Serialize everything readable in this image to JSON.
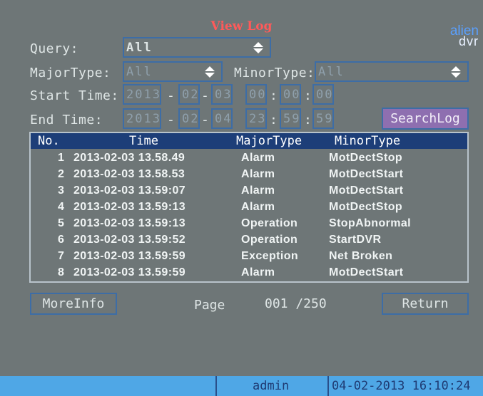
{
  "title": "View Log",
  "logo": {
    "line1": "alien",
    "line2": "dvr"
  },
  "query": {
    "label": "Query:",
    "value": "All"
  },
  "major_type": {
    "label": "MajorType:",
    "value": "All"
  },
  "minor_type": {
    "label": "MinorType:",
    "value": "All"
  },
  "start_time": {
    "label": "Start Time:",
    "year": "2013",
    "month": "02",
    "day": "03",
    "hour": "00",
    "minute": "00",
    "second": "00"
  },
  "end_time": {
    "label": "End Time:",
    "year": "2013",
    "month": "02",
    "day": "04",
    "hour": "23",
    "minute": "59",
    "second": "59"
  },
  "search_button": "SearchLog",
  "table": {
    "headers": [
      "No.",
      "Time",
      "MajorType",
      "MinorType"
    ],
    "rows": [
      {
        "no": "1",
        "time": "2013-02-03 13.58.49",
        "major": "Alarm",
        "minor": "MotDectStop"
      },
      {
        "no": "2",
        "time": "2013-02-03 13.58.53",
        "major": "Alarm",
        "minor": "MotDectStart"
      },
      {
        "no": "3",
        "time": "2013-02-03 13.59:07",
        "major": "Alarm",
        "minor": "MotDectStart"
      },
      {
        "no": "4",
        "time": "2013-02-03 13.59:13",
        "major": "Alarm",
        "minor": "MotDectStop"
      },
      {
        "no": "5",
        "time": "2013-02-03 13.59:13",
        "major": "Operation",
        "minor": "StopAbnormal"
      },
      {
        "no": "6",
        "time": "2013-02-03 13.59:52",
        "major": "Operation",
        "minor": "StartDVR"
      },
      {
        "no": "7",
        "time": "2013-02-03 13.59:59",
        "major": "Exception",
        "minor": "Net Broken"
      },
      {
        "no": "8",
        "time": "2013-02-03 13.59:59",
        "major": "Alarm",
        "minor": "MotDectStart"
      }
    ]
  },
  "more_info_button": "MoreInfo",
  "pager": {
    "label": "Page",
    "value": "001 /250"
  },
  "return_button": "Return",
  "status": {
    "user": "admin",
    "datetime": "04-02-2013 16:10:24"
  }
}
